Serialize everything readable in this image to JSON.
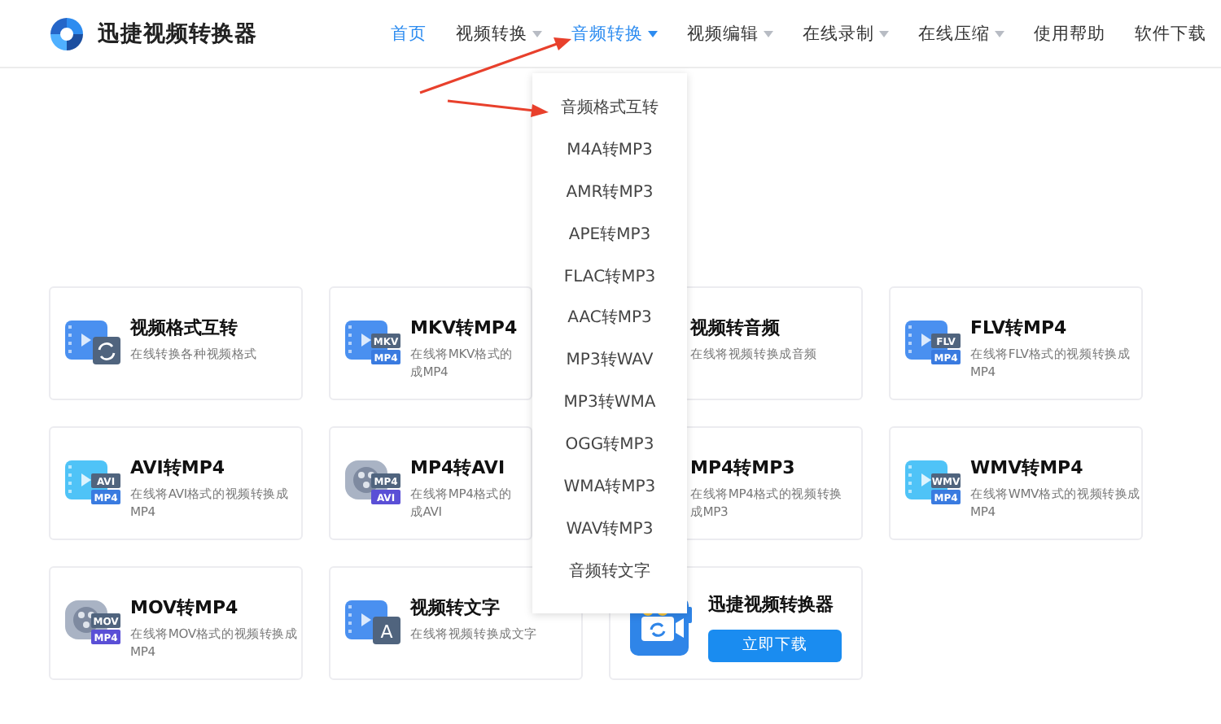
{
  "brand": {
    "name": "迅捷视频转换器"
  },
  "nav": [
    {
      "label": "首页",
      "selected": true,
      "has_menu": false
    },
    {
      "label": "视频转换",
      "selected": false,
      "has_menu": true
    },
    {
      "label": "音频转换",
      "selected": true,
      "has_menu": true
    },
    {
      "label": "视频编辑",
      "selected": false,
      "has_menu": true
    },
    {
      "label": "在线录制",
      "selected": false,
      "has_menu": true
    },
    {
      "label": "在线压缩",
      "selected": false,
      "has_menu": true
    },
    {
      "label": "使用帮助",
      "selected": false,
      "has_menu": false
    },
    {
      "label": "软件下载",
      "selected": false,
      "has_menu": false
    }
  ],
  "dropdown": {
    "items": [
      "音频格式互转",
      "M4A转MP3",
      "AMR转MP3",
      "APE转MP3",
      "FLAC转MP3",
      "AAC转MP3",
      "MP3转WAV",
      "MP3转WMA",
      "OGG转MP3",
      "WMA转MP3",
      "WAV转MP3",
      "音频转文字"
    ]
  },
  "cards": [
    {
      "kind": "tool",
      "title": "视频格式互转",
      "desc": [
        "在线转换各种视频格式"
      ],
      "icon": {
        "kind": "film-sync"
      }
    },
    {
      "kind": "tool",
      "title": "MKV转MP4",
      "desc": [
        "在线将MKV格式的",
        "成MP4"
      ],
      "icon": {
        "kind": "film",
        "badges": [
          "MKV",
          "MP4"
        ]
      }
    },
    {
      "kind": "tool",
      "title": "视频转音频",
      "desc": [
        "在线将视频转换成音频"
      ]
    },
    {
      "kind": "tool",
      "title": "FLV转MP4",
      "desc": [
        "在线将FLV格式的视频转换成",
        "MP4"
      ],
      "icon": {
        "kind": "film",
        "badges": [
          "FLV",
          "MP4"
        ]
      }
    },
    {
      "kind": "tool",
      "title": "AVI转MP4",
      "desc": [
        "在线将AVI格式的视频转换成",
        "MP4"
      ],
      "icon": {
        "kind": "film-light",
        "badges": [
          "AVI",
          "MP4"
        ]
      }
    },
    {
      "kind": "tool",
      "title": "MP4转AVI",
      "desc": [
        "在线将MP4格式的",
        "成AVI"
      ],
      "icon": {
        "kind": "reel",
        "badges": [
          "MP4",
          "AVI"
        ]
      }
    },
    {
      "kind": "tool",
      "title": "MP4转MP3",
      "desc": [
        "在线将MP4格式的视频转换",
        "成MP3"
      ]
    },
    {
      "kind": "tool",
      "title": "WMV转MP4",
      "desc": [
        "在线将WMV格式的视频转换成",
        "MP4"
      ],
      "icon": {
        "kind": "film-light",
        "badges": [
          "WMV",
          "MP4"
        ]
      }
    },
    {
      "kind": "tool",
      "title": "MOV转MP4",
      "desc": [
        "在线将MOV格式的视频转换成",
        "MP4"
      ],
      "icon": {
        "kind": "reel",
        "badges": [
          "MOV",
          "MP4"
        ]
      }
    },
    {
      "kind": "tool",
      "title": "视频转文字",
      "desc": [
        "在线将视频转换成文字"
      ],
      "icon": {
        "kind": "film-text",
        "badges": [
          "A"
        ]
      }
    },
    {
      "kind": "app",
      "title": "迅捷视频转换器",
      "button": "立即下载"
    }
  ]
}
